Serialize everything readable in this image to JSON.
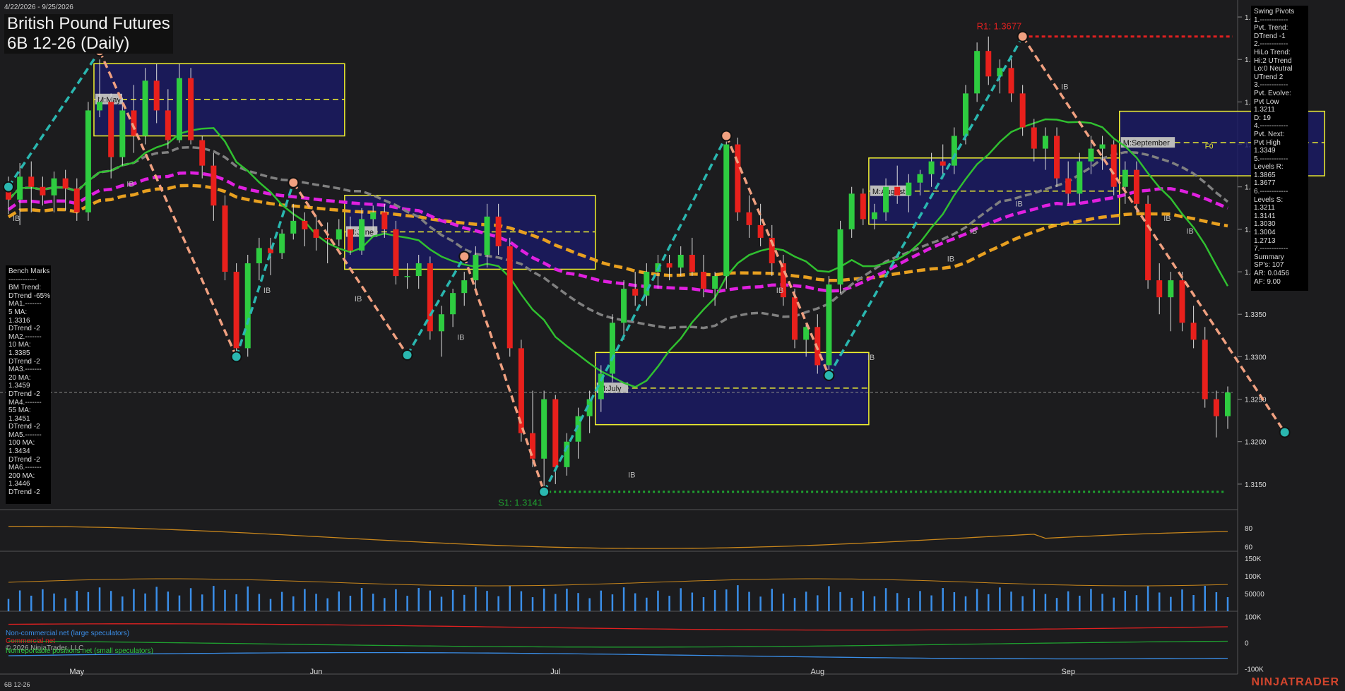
{
  "header": {
    "date_range": "4/22/2026 - 9/25/2026",
    "title_line1": "British Pound Futures",
    "title_line2": "6B 12-26 (Daily)",
    "symbol_footer": "6B 12-26",
    "brand": "NINJATRADER",
    "copyright": "© 2026 NinjaTrader, LLC"
  },
  "colors": {
    "background": "#1c1c1e",
    "up_bar": "#2ecc40",
    "down_bar": "#e8201c",
    "cyan_swing": "#2ab7b0",
    "salmon_swing": "#f0a080",
    "magenta_ma": "#e020e0",
    "orange_ma": "#e8a020",
    "gray_ma": "#808080",
    "green_ma": "#30c030",
    "value_area_fill": "#1a1a66",
    "value_area_border": "#f0f030",
    "resistance": "#e02020",
    "support": "#1fa030",
    "volume": "#3a8ee8"
  },
  "swing_panel": {
    "lines": [
      "Swing Pivots",
      "1.------------",
      "Pvt. Trend:",
      "DTrend -1",
      "2.------------",
      "HiLo Trend:",
      "Hi:2 UTrend",
      "Lo:0 Neutral",
      "UTrend 2",
      "3.------------",
      "Pvt. Evolve:",
      "Pvt Low",
      "1.3211",
      "D: 19",
      "4.------------",
      "Pvt. Next:",
      "Pvt High",
      "1.3349",
      "5.------------",
      "Levels R:",
      "1.3865",
      "1.3677",
      "6.------------",
      "Levels S:",
      "1.3211",
      "1.3141",
      "1.3030",
      "1.3004",
      "1.2713",
      "7.------------",
      "Summary",
      "SP's: 107",
      "AR: 0.0456",
      "AF: 9.00"
    ]
  },
  "bench_panel": {
    "lines": [
      "Bench Marks",
      "------------",
      "BM Trend:",
      "DTrend -65%",
      "MA1.-------",
      "5 MA:",
      "1.3316",
      "DTrend -2",
      "MA2.-------",
      "10 MA:",
      "1.3385",
      "DTrend -2",
      "MA3.-------",
      "20 MA:",
      "1.3459",
      "DTrend -2",
      "MA4.-------",
      "55 MA:",
      "1.3451",
      "DTrend -2",
      "MA5.-------",
      "100 MA:",
      "1.3434",
      "DTrend -2",
      "MA6.-------",
      "200 MA:",
      "1.3446",
      "DTrend -2"
    ]
  },
  "legend": {
    "noncommercial": "Non-commercial net (large speculators)",
    "commercial": "Commercial net",
    "nonreportable": "Nonreportable positions net (small speculators)"
  },
  "annotations": {
    "r1": "R1: 1.3677",
    "s1": "S1: 1.3141",
    "ib": "IB",
    "f0": "F0",
    "va_labels": [
      "M:May",
      "M:June",
      "M:July",
      "M:August",
      "M:September"
    ]
  },
  "chart_data": {
    "type": "candlestick",
    "price_axis": {
      "range": [
        1.312,
        1.372
      ],
      "ticks": [
        "1.3700",
        "1.3650",
        "1.3600",
        "1.3550",
        "1.3500",
        "1.3450",
        "1.3400",
        "1.3350",
        "1.3300",
        "1.3250",
        "1.3200",
        "1.3150"
      ],
      "last_price_marker": 1.3258
    },
    "x_axis": {
      "labels": [
        "May",
        "Jun",
        "Jul",
        "Aug",
        "Sep"
      ],
      "label_days": [
        6,
        27,
        48,
        71,
        93
      ]
    },
    "candles": [
      [
        1.35,
        1.3512,
        1.3468,
        1.3485
      ],
      [
        1.3485,
        1.3528,
        1.3455,
        1.3512
      ],
      [
        1.3512,
        1.353,
        1.347,
        1.35
      ],
      [
        1.35,
        1.3512,
        1.3478,
        1.349
      ],
      [
        1.349,
        1.3518,
        1.347,
        1.351
      ],
      [
        1.351,
        1.352,
        1.3472,
        1.3498
      ],
      [
        1.3498,
        1.351,
        1.346,
        1.347
      ],
      [
        1.347,
        1.36,
        1.346,
        1.359
      ],
      [
        1.359,
        1.365,
        1.3582,
        1.36
      ],
      [
        1.36,
        1.361,
        1.351,
        1.3535
      ],
      [
        1.3535,
        1.3605,
        1.3525,
        1.359
      ],
      [
        1.359,
        1.362,
        1.354,
        1.356
      ],
      [
        1.356,
        1.364,
        1.355,
        1.3625
      ],
      [
        1.3625,
        1.3645,
        1.3575,
        1.359
      ],
      [
        1.359,
        1.3615,
        1.3545,
        1.3555
      ],
      [
        1.3555,
        1.3645,
        1.3552,
        1.3628
      ],
      [
        1.3628,
        1.364,
        1.355,
        1.3555
      ],
      [
        1.3555,
        1.356,
        1.351,
        1.3525
      ],
      [
        1.3525,
        1.354,
        1.346,
        1.3478
      ],
      [
        1.3478,
        1.349,
        1.339,
        1.34
      ],
      [
        1.34,
        1.341,
        1.33,
        1.331
      ],
      [
        1.331,
        1.342,
        1.33,
        1.341
      ],
      [
        1.341,
        1.344,
        1.339,
        1.3428
      ],
      [
        1.3428,
        1.344,
        1.3396,
        1.3422
      ],
      [
        1.3422,
        1.345,
        1.3415,
        1.3445
      ],
      [
        1.3445,
        1.348,
        1.3438,
        1.346
      ],
      [
        1.346,
        1.347,
        1.343,
        1.345
      ],
      [
        1.345,
        1.3465,
        1.3425,
        1.344
      ],
      [
        1.344,
        1.3458,
        1.341,
        1.3438
      ],
      [
        1.3438,
        1.3462,
        1.343,
        1.345
      ],
      [
        1.345,
        1.3465,
        1.342,
        1.3425
      ],
      [
        1.3425,
        1.3475,
        1.342,
        1.3462
      ],
      [
        1.3462,
        1.3478,
        1.3448,
        1.347
      ],
      [
        1.347,
        1.348,
        1.344,
        1.345
      ],
      [
        1.345,
        1.346,
        1.3385,
        1.3395
      ],
      [
        1.3395,
        1.341,
        1.338,
        1.3395
      ],
      [
        1.3395,
        1.342,
        1.338,
        1.341
      ],
      [
        1.341,
        1.3418,
        1.332,
        1.333
      ],
      [
        1.333,
        1.336,
        1.33,
        1.335
      ],
      [
        1.335,
        1.338,
        1.3335,
        1.3375
      ],
      [
        1.3375,
        1.34,
        1.336,
        1.339
      ],
      [
        1.339,
        1.343,
        1.338,
        1.342
      ],
      [
        1.342,
        1.348,
        1.3405,
        1.3465
      ],
      [
        1.3465,
        1.348,
        1.342,
        1.343
      ],
      [
        1.343,
        1.344,
        1.33,
        1.331
      ],
      [
        1.331,
        1.332,
        1.32,
        1.321
      ],
      [
        1.321,
        1.326,
        1.317,
        1.318
      ],
      [
        1.318,
        1.326,
        1.314,
        1.325
      ],
      [
        1.325,
        1.3255,
        1.315,
        1.317
      ],
      [
        1.317,
        1.321,
        1.316,
        1.32
      ],
      [
        1.32,
        1.324,
        1.318,
        1.323
      ],
      [
        1.323,
        1.326,
        1.321,
        1.325
      ],
      [
        1.325,
        1.329,
        1.3235,
        1.328
      ],
      [
        1.328,
        1.335,
        1.327,
        1.334
      ],
      [
        1.334,
        1.339,
        1.332,
        1.338
      ],
      [
        1.338,
        1.34,
        1.336,
        1.3372
      ],
      [
        1.3372,
        1.341,
        1.336,
        1.34
      ],
      [
        1.34,
        1.342,
        1.338,
        1.341
      ],
      [
        1.341,
        1.342,
        1.339,
        1.3405
      ],
      [
        1.3405,
        1.343,
        1.3395,
        1.342
      ],
      [
        1.342,
        1.344,
        1.3395,
        1.34
      ],
      [
        1.34,
        1.342,
        1.337,
        1.338
      ],
      [
        1.338,
        1.34,
        1.336,
        1.3395
      ],
      [
        1.3395,
        1.356,
        1.338,
        1.355
      ],
      [
        1.355,
        1.3558,
        1.346,
        1.347
      ],
      [
        1.347,
        1.349,
        1.344,
        1.3455
      ],
      [
        1.3455,
        1.348,
        1.343,
        1.344
      ],
      [
        1.344,
        1.3455,
        1.3395,
        1.341
      ],
      [
        1.341,
        1.342,
        1.336,
        1.337
      ],
      [
        1.337,
        1.338,
        1.331,
        1.332
      ],
      [
        1.332,
        1.334,
        1.33,
        1.3335
      ],
      [
        1.3335,
        1.335,
        1.328,
        1.329
      ],
      [
        1.329,
        1.3395,
        1.328,
        1.3385
      ],
      [
        1.3385,
        1.346,
        1.3375,
        1.345
      ],
      [
        1.345,
        1.35,
        1.344,
        1.3492
      ],
      [
        1.3492,
        1.3498,
        1.3455,
        1.3462
      ],
      [
        1.3462,
        1.348,
        1.345,
        1.347
      ],
      [
        1.347,
        1.351,
        1.346,
        1.35
      ],
      [
        1.35,
        1.3525,
        1.348,
        1.349
      ],
      [
        1.349,
        1.3515,
        1.347,
        1.3505
      ],
      [
        1.3505,
        1.352,
        1.349,
        1.3515
      ],
      [
        1.3515,
        1.354,
        1.35,
        1.353
      ],
      [
        1.353,
        1.355,
        1.351,
        1.3525
      ],
      [
        1.3525,
        1.357,
        1.3515,
        1.356
      ],
      [
        1.356,
        1.362,
        1.355,
        1.361
      ],
      [
        1.361,
        1.367,
        1.36,
        1.366
      ],
      [
        1.366,
        1.3677,
        1.362,
        1.363
      ],
      [
        1.363,
        1.365,
        1.361,
        1.364
      ],
      [
        1.364,
        1.3655,
        1.36,
        1.361
      ],
      [
        1.361,
        1.362,
        1.356,
        1.357
      ],
      [
        1.357,
        1.358,
        1.353,
        1.3545
      ],
      [
        1.3545,
        1.357,
        1.352,
        1.356
      ],
      [
        1.356,
        1.357,
        1.35,
        1.351
      ],
      [
        1.351,
        1.353,
        1.348,
        1.3492
      ],
      [
        1.3492,
        1.354,
        1.348,
        1.353
      ],
      [
        1.353,
        1.356,
        1.3515,
        1.3545
      ],
      [
        1.3545,
        1.356,
        1.352,
        1.355
      ],
      [
        1.355,
        1.3555,
        1.349,
        1.35
      ],
      [
        1.35,
        1.353,
        1.348,
        1.352
      ],
      [
        1.352,
        1.353,
        1.347,
        1.348
      ],
      [
        1.348,
        1.349,
        1.338,
        1.339
      ],
      [
        1.339,
        1.341,
        1.335,
        1.337
      ],
      [
        1.337,
        1.34,
        1.333,
        1.339
      ],
      [
        1.339,
        1.34,
        1.333,
        1.334
      ],
      [
        1.334,
        1.336,
        1.331,
        1.332
      ],
      [
        1.332,
        1.3335,
        1.324,
        1.325
      ],
      [
        1.325,
        1.326,
        1.3205,
        1.323
      ],
      [
        1.323,
        1.3265,
        1.3215,
        1.3258
      ]
    ],
    "moving_averages": [
      {
        "name": "5 MA",
        "value": 1.3316
      },
      {
        "name": "10 MA",
        "value": 1.3385
      },
      {
        "name": "20 MA",
        "value": 1.3459
      },
      {
        "name": "55 MA",
        "value": 1.3451
      },
      {
        "name": "100 MA",
        "value": 1.3434
      },
      {
        "name": "200 MA",
        "value": 1.3446
      }
    ],
    "swing_pivots": [
      {
        "day": 0,
        "price": 1.35,
        "type": "low"
      },
      {
        "day": 8,
        "price": 1.366,
        "type": "high"
      },
      {
        "day": 20,
        "price": 1.33,
        "type": "low"
      },
      {
        "day": 25,
        "price": 1.3505,
        "type": "high"
      },
      {
        "day": 35,
        "price": 1.3302,
        "type": "low"
      },
      {
        "day": 40,
        "price": 1.3418,
        "type": "high"
      },
      {
        "day": 47,
        "price": 1.3141,
        "type": "low"
      },
      {
        "day": 63,
        "price": 1.356,
        "type": "high"
      },
      {
        "day": 72,
        "price": 1.3278,
        "type": "low"
      },
      {
        "day": 89,
        "price": 1.3677,
        "type": "high"
      },
      {
        "day": 112,
        "price": 1.3211,
        "type": "low"
      }
    ],
    "value_areas": [
      {
        "label": "M:May",
        "start_day": 8,
        "end_day": 29,
        "high": 1.3645,
        "low": 1.356,
        "poc": 1.3603
      },
      {
        "label": "M:June",
        "start_day": 30,
        "end_day": 51,
        "high": 1.349,
        "low": 1.3403,
        "poc": 1.3447
      },
      {
        "label": "M:July",
        "start_day": 52,
        "end_day": 75,
        "high": 1.3305,
        "low": 1.322,
        "poc": 1.3263
      },
      {
        "label": "M:August",
        "start_day": 76,
        "end_day": 97,
        "high": 1.3534,
        "low": 1.3456,
        "poc": 1.3495
      },
      {
        "label": "M:September",
        "start_day": 98,
        "end_day": 115,
        "high": 1.3589,
        "low": 1.3513,
        "poc": 1.3552
      }
    ],
    "levels": {
      "r1": 1.3677,
      "s1": 1.3141
    },
    "oscillator": {
      "ticks": [
        80,
        60
      ],
      "range": [
        55,
        100
      ]
    },
    "volume": {
      "ticks": [
        "150K",
        "100K",
        "50000"
      ],
      "range": [
        0,
        170000
      ]
    },
    "cot": {
      "ticks": [
        "100K",
        "0",
        "-100K"
      ],
      "range": [
        -120000,
        120000
      ],
      "series": [
        {
          "name": "Non-commercial net (large speculators)",
          "value": -50000
        },
        {
          "name": "Commercial net",
          "value": 60000
        },
        {
          "name": "Nonreportable positions net (small speculators)",
          "value": -5000
        }
      ]
    }
  }
}
